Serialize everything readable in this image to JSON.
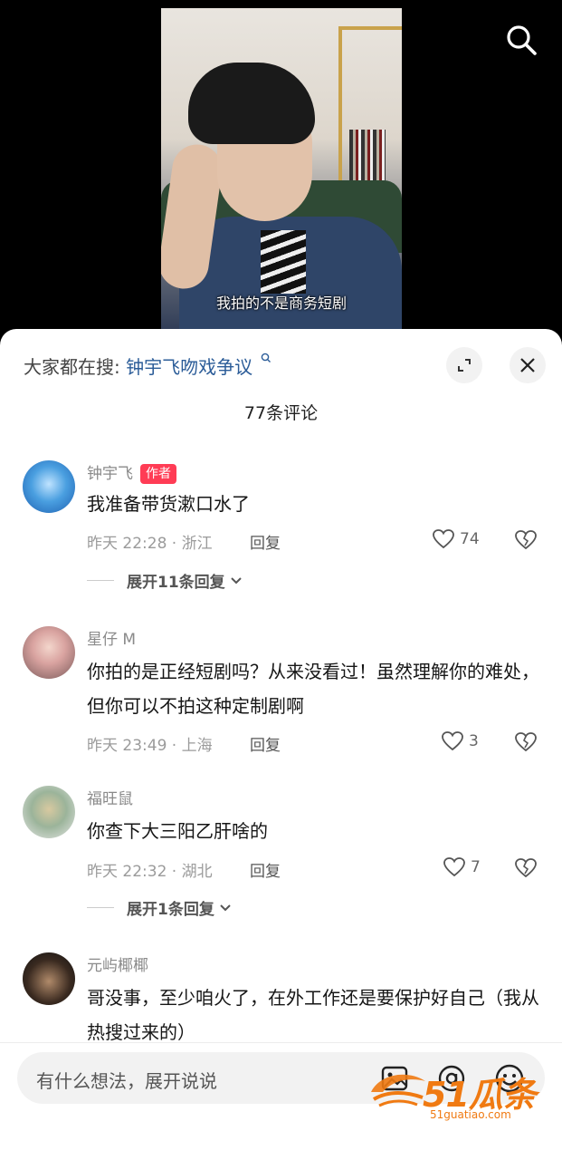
{
  "video": {
    "subtitle": "我拍的不是商务短剧"
  },
  "sheet": {
    "hot_search_prefix": "大家都在搜:",
    "hot_search_term": "钟宇飞吻戏争议",
    "comment_count": "77条评论"
  },
  "comments": [
    {
      "user": "钟宇飞",
      "badge": "作者",
      "text": "我准备带货漱口水了",
      "time_loc": "昨天 22:28 · 浙江",
      "reply_label": "回复",
      "likes": "74",
      "expand": "展开11条回复"
    },
    {
      "user": "星仔 M",
      "text": "你拍的是正经短剧吗？从来没看过！虽然理解你的难处，但你可以不拍这种定制剧啊",
      "time_loc": "昨天 23:49 · 上海",
      "reply_label": "回复",
      "likes": "3"
    },
    {
      "user": "福旺鼠",
      "text": "你查下大三阳乙肝啥的",
      "time_loc": "昨天 22:32 · 湖北",
      "reply_label": "回复",
      "likes": "7",
      "expand": "展开1条回复"
    },
    {
      "user": "元屿椰椰",
      "text": "哥没事，至少咱火了，在外工作还是要保护好自己（我从热搜过来的）"
    }
  ],
  "input": {
    "placeholder": "有什么想法，展开说说"
  },
  "watermark": {
    "brand": "51瓜条",
    "url": "51guatiao.com"
  },
  "colors": {
    "badge": "#ff3c55",
    "hot_term": "#2b5c98",
    "watermark": "#f07a12"
  },
  "icons": [
    "search-icon",
    "expand-icon",
    "close-icon",
    "heart-icon",
    "broken-heart-icon",
    "chevron-down-icon",
    "image-icon",
    "at-icon",
    "emoji-icon"
  ]
}
